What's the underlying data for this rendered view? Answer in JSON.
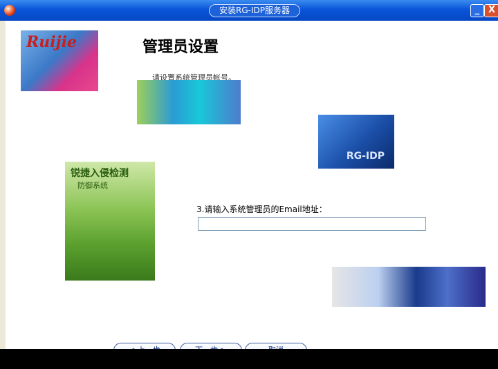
{
  "window": {
    "title": "安装RG-IDP服务器",
    "minimize_glyph": "_",
    "close_glyph": "X"
  },
  "page": {
    "title": "管理员设置",
    "instruction": "请设置系统管理员帐号。",
    "step3_label": "3.请输入系统管理员的Email地址：",
    "email_value": ""
  },
  "branding": {
    "logo_text": "Ruijie",
    "ids_label": "RG-IDP",
    "product_title": "锐捷入侵检测",
    "product_subtitle": "防御系统"
  },
  "buttons": {
    "back": "< 上一步",
    "next": "下一步 >",
    "cancel": "取消"
  },
  "colors": {
    "titlebar": "#0a55d8",
    "window_bg": "#ECE9D8",
    "close_button": "#d9502c"
  },
  "icons": [
    "app-icon",
    "minimize-icon",
    "close-icon"
  ]
}
